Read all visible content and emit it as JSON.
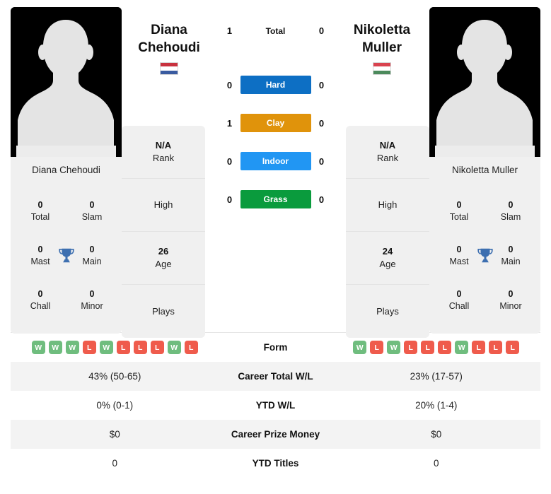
{
  "players": {
    "left": {
      "first_name": "Diana",
      "last_name": "Chehoudi",
      "full_name": "Diana Chehoudi",
      "flag_country": "netherlands",
      "flag_colors": [
        "#c8313e",
        "#ffffff",
        "#3a5ba0"
      ],
      "avatar": "player-avatar-placeholder",
      "titles": {
        "total": "0",
        "total_label": "Total",
        "slam": "0",
        "slam_label": "Slam",
        "mast": "0",
        "mast_label": "Mast",
        "main": "0",
        "main_label": "Main",
        "chall": "0",
        "chall_label": "Chall",
        "minor": "0",
        "minor_label": "Minor"
      },
      "info": [
        {
          "value": "N/A",
          "label": "Rank"
        },
        {
          "value": "",
          "label": "High"
        },
        {
          "value": "26",
          "label": "Age"
        },
        {
          "value": "",
          "label": "Plays"
        }
      ],
      "form": [
        "W",
        "W",
        "W",
        "L",
        "W",
        "L",
        "L",
        "L",
        "W",
        "L"
      ]
    },
    "right": {
      "first_name": "Nikoletta",
      "last_name": "Muller",
      "full_name": "Nikoletta Muller",
      "flag_country": "hungary",
      "flag_colors": [
        "#d9434f",
        "#ffffff",
        "#4c8a5c"
      ],
      "avatar": "player-avatar-placeholder",
      "titles": {
        "total": "0",
        "total_label": "Total",
        "slam": "0",
        "slam_label": "Slam",
        "mast": "0",
        "mast_label": "Mast",
        "main": "0",
        "main_label": "Main",
        "chall": "0",
        "chall_label": "Chall",
        "minor": "0",
        "minor_label": "Minor"
      },
      "info": [
        {
          "value": "N/A",
          "label": "Rank"
        },
        {
          "value": "",
          "label": "High"
        },
        {
          "value": "24",
          "label": "Age"
        },
        {
          "value": "",
          "label": "Plays"
        }
      ],
      "form": [
        "W",
        "L",
        "W",
        "L",
        "L",
        "L",
        "W",
        "L",
        "L",
        "L"
      ]
    }
  },
  "head_to_head": [
    {
      "label": "Total",
      "left": "1",
      "right": "0",
      "style": "plain",
      "color": ""
    },
    {
      "label": "Hard",
      "left": "0",
      "right": "0",
      "style": "badge",
      "color": "#0d6fc4"
    },
    {
      "label": "Clay",
      "left": "1",
      "right": "0",
      "style": "badge",
      "color": "#e0930b"
    },
    {
      "label": "Indoor",
      "left": "0",
      "right": "0",
      "style": "badge",
      "color": "#2196f3"
    },
    {
      "label": "Grass",
      "left": "0",
      "right": "0",
      "style": "badge",
      "color": "#0a9b3d"
    }
  ],
  "form_row": {
    "label": "Form"
  },
  "stats_table": [
    {
      "label": "Career Total W/L",
      "left": "43% (50-65)",
      "right": "23% (17-57)"
    },
    {
      "label": "YTD W/L",
      "left": "0% (0-1)",
      "right": "20% (1-4)"
    },
    {
      "label": "Career Prize Money",
      "left": "$0",
      "right": "$0"
    },
    {
      "label": "YTD Titles",
      "left": "0",
      "right": "0"
    }
  ],
  "colors": {
    "card_bg": "#f0f0f0",
    "table_alt_bg": "#f3f3f3",
    "trophy": "#3d6fb0",
    "win_badge": "#6fbd7e",
    "loss_badge": "#ef5b4c"
  }
}
